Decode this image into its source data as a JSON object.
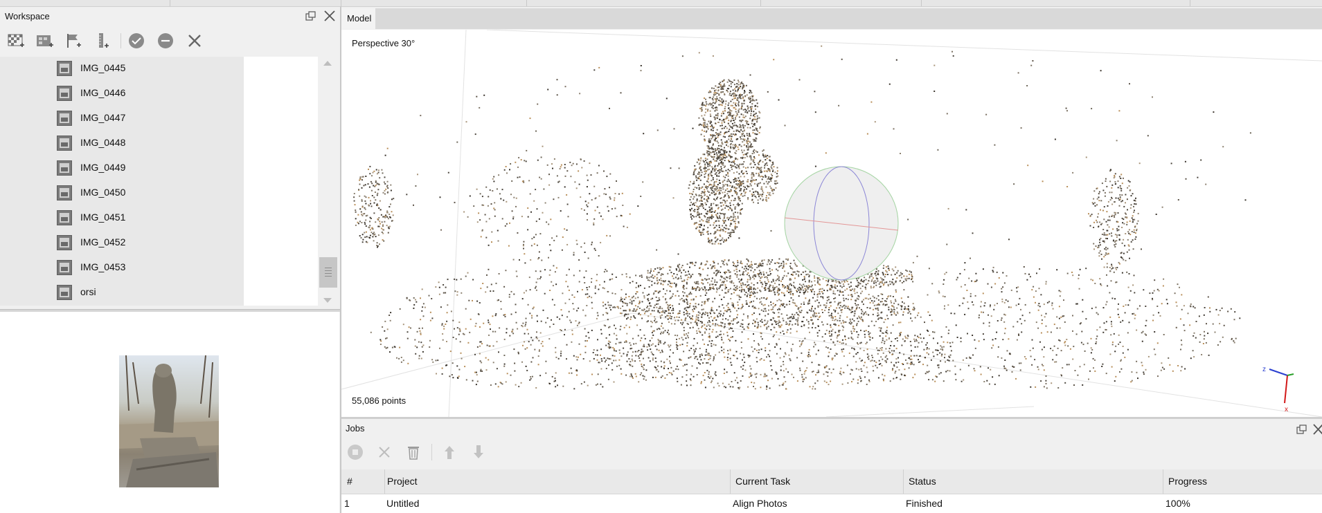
{
  "workspace": {
    "title": "Workspace",
    "toolbar": [
      {
        "icon": "add-photos-icon"
      },
      {
        "icon": "add-folder-icon"
      },
      {
        "icon": "add-marker-icon"
      },
      {
        "icon": "add-scalebar-icon"
      },
      {
        "icon": "enable-check-icon"
      },
      {
        "icon": "disable-minus-icon"
      },
      {
        "icon": "remove-cross-icon"
      }
    ],
    "items": [
      {
        "label": "IMG_0445"
      },
      {
        "label": "IMG_0446"
      },
      {
        "label": "IMG_0447"
      },
      {
        "label": "IMG_0448"
      },
      {
        "label": "IMG_0449"
      },
      {
        "label": "IMG_0450"
      },
      {
        "label": "IMG_0451"
      },
      {
        "label": "IMG_0452"
      },
      {
        "label": "IMG_0453"
      },
      {
        "label": "orsi"
      }
    ]
  },
  "model": {
    "tab": "Model",
    "view_label": "Perspective 30°",
    "point_count": "55,086 points"
  },
  "jobs": {
    "title": "Jobs",
    "columns": [
      "#",
      "Project",
      "Current Task",
      "Status",
      "Progress"
    ],
    "rows": [
      {
        "num": "1",
        "project": "Untitled",
        "task": "Align Photos",
        "status": "Finished",
        "progress": "100%"
      }
    ]
  }
}
